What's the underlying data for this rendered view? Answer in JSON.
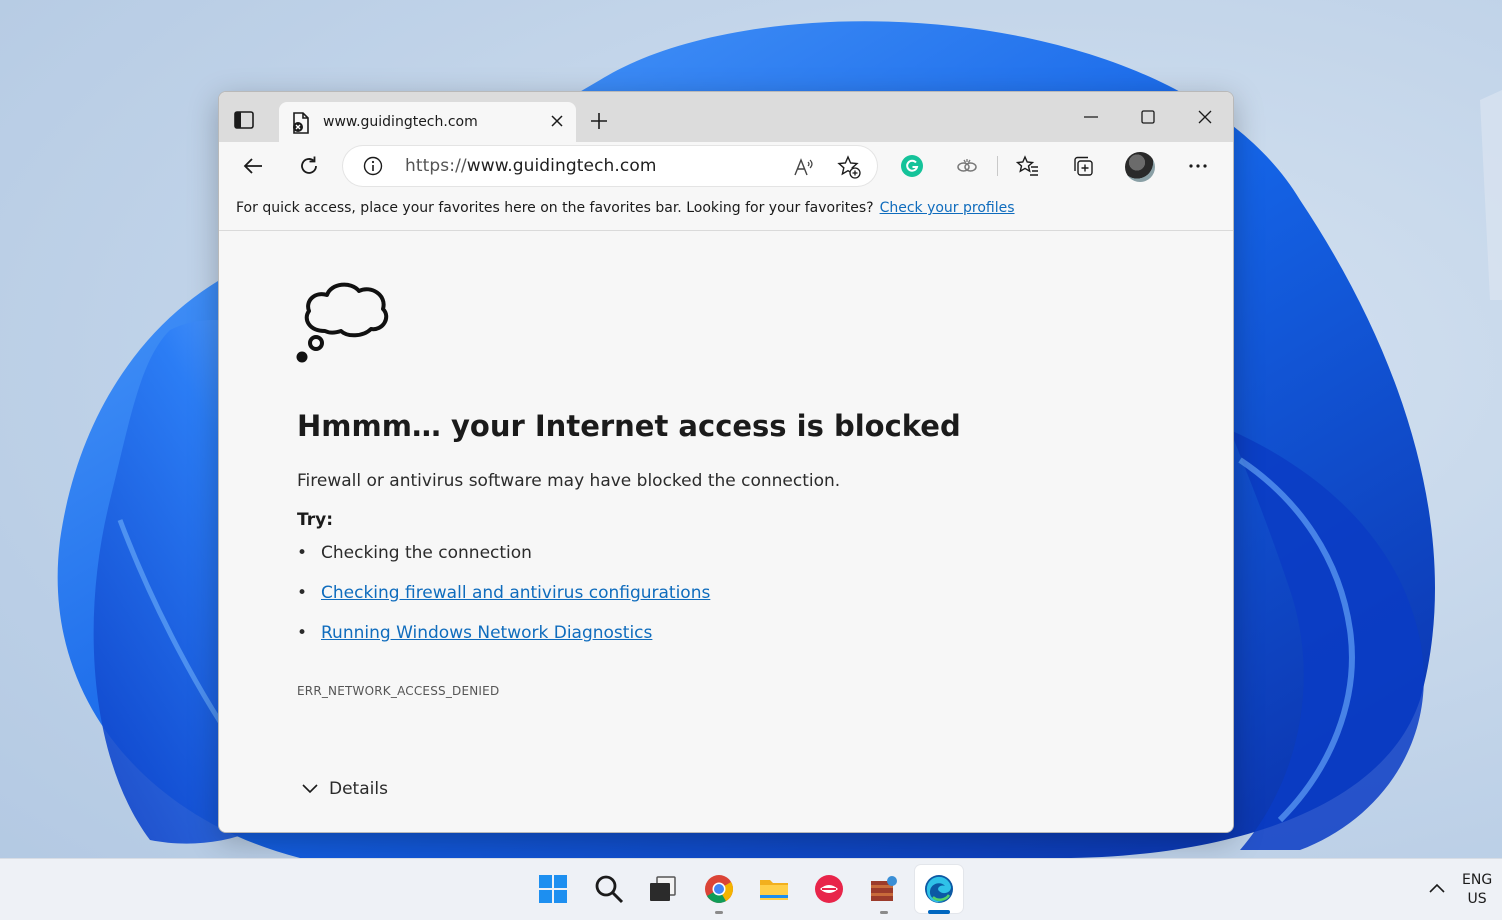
{
  "browser": {
    "tab_title": "www.guidingtech.com",
    "address_scheme": "https://",
    "address_host": "www.guidingtech.com"
  },
  "favorites_bar": {
    "message": "For quick access, place your favorites here on the favorites bar. Looking for your favorites?",
    "link": "Check your profiles"
  },
  "error_page": {
    "heading": "Hmmm… your Internet access is blocked",
    "description": "Firewall or antivirus software may have blocked the connection.",
    "try_label": "Try:",
    "suggestions": [
      "Checking the connection",
      "Checking firewall and antivirus configurations",
      "Running Windows Network Diagnostics"
    ],
    "error_code": "ERR_NETWORK_ACCESS_DENIED",
    "details_label": "Details"
  },
  "taskbar": {
    "language_line1": "ENG",
    "language_line2": "US",
    "apps": [
      "start-icon",
      "search-icon",
      "task-view-icon",
      "chrome-icon",
      "file-explorer-icon",
      "app-icon",
      "winrar-icon",
      "edge-icon"
    ]
  },
  "colors": {
    "link": "#0f6cbd",
    "grammarly": "#15c39a",
    "taskbar_accent": "#0067c0"
  }
}
